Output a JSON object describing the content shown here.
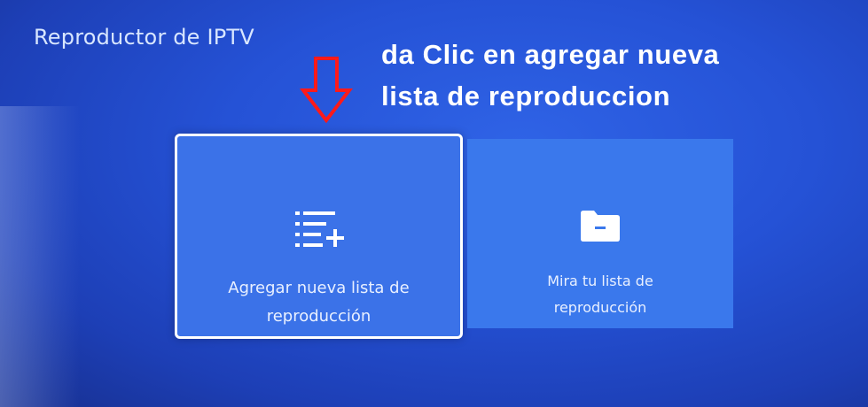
{
  "app": {
    "title": "Reproductor de IPTV"
  },
  "overlay": {
    "instruction_line1": "da Clic en agregar nueva",
    "instruction_line2": "lista de reproduccion",
    "arrow_color": "#ff1a1a"
  },
  "tiles": [
    {
      "icon": "playlist-add-icon",
      "label_line1": "Agregar nueva lista de",
      "label_line2": "reproducción",
      "focused": true
    },
    {
      "icon": "folder-icon",
      "label_line1": "Mira tu lista de",
      "label_line2": "reproducción",
      "focused": false
    }
  ],
  "colors": {
    "background": "#2552d6",
    "tile": "#3a74ea",
    "focus_border": "#ffffff"
  }
}
